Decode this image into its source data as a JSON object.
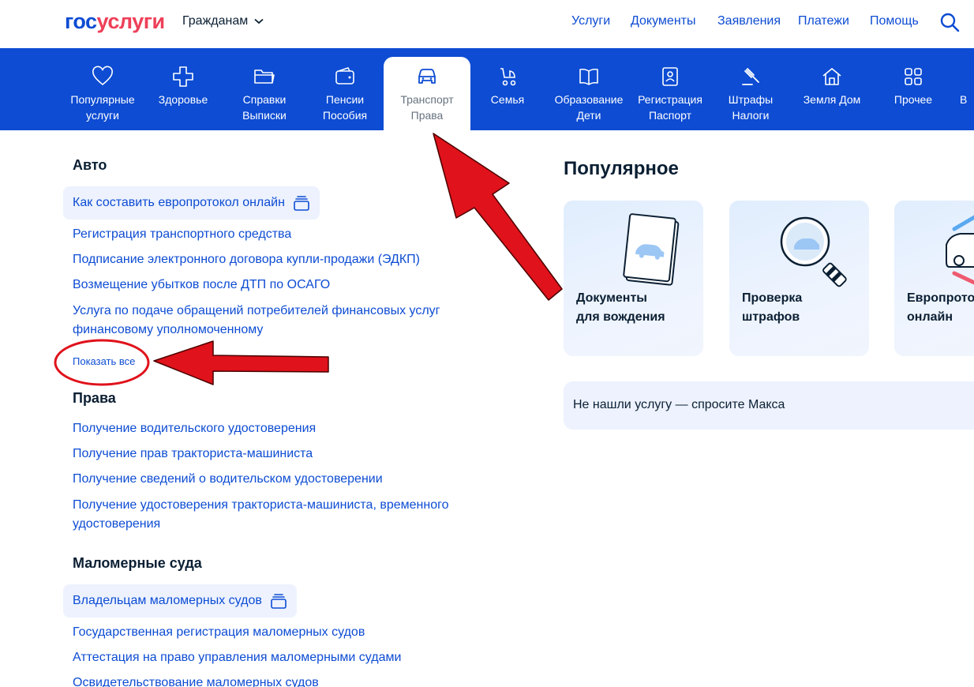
{
  "header": {
    "logo_part1": "гос",
    "logo_part2": "услуги",
    "audience": "Гражданам",
    "nav": [
      "Услуги",
      "Документы",
      "Заявления",
      "Платежи",
      "Помощь"
    ]
  },
  "categories": [
    {
      "label": "Популярные\nуслуги",
      "icon": "heart-icon"
    },
    {
      "label": "Здоровье",
      "icon": "medical-cross-icon"
    },
    {
      "label": "Справки\nВыписки",
      "icon": "folder-icon"
    },
    {
      "label": "Пенсии\nПособия",
      "icon": "wallet-icon"
    },
    {
      "label": "Транспорт\nПрава",
      "icon": "car-icon",
      "active": true
    },
    {
      "label": "Семья",
      "icon": "stroller-icon"
    },
    {
      "label": "Образование\nДети",
      "icon": "book-icon"
    },
    {
      "label": "Регистрация\nПаспорт",
      "icon": "passport-icon"
    },
    {
      "label": "Штрафы\nНалоги",
      "icon": "gavel-icon"
    },
    {
      "label": "Земля Дом",
      "icon": "house-icon"
    },
    {
      "label": "Прочее",
      "icon": "grid-icon"
    },
    {
      "label": "В",
      "icon": ""
    }
  ],
  "sections": {
    "auto": {
      "title": "Авто",
      "chip": "Как составить европротокол онлайн",
      "links": [
        "Регистрация транспортного средства",
        "Подписание электронного договора купли-продажи (ЭДКП)",
        "Возмещение убытков после ДТП по ОСАГО",
        "Услуга по подаче обращений потребителей финансовых услуг",
        "финансовому уполномоченному"
      ],
      "show_all": "Показать все"
    },
    "rights": {
      "title": "Права",
      "links": [
        "Получение водительского удостоверения",
        "Получение прав тракториста-машиниста",
        "Получение сведений о водительском удостоверении",
        "Получение удостоверения тракториста-машиниста, временного",
        "удостоверения"
      ]
    },
    "boats": {
      "title": "Маломерные суда",
      "chip": "Владельцам маломерных судов",
      "links": [
        "Государственная регистрация маломерных судов",
        "Аттестация на право управления маломерными судами",
        "Освидетельствование маломерных судов"
      ]
    }
  },
  "popular": {
    "title": "Популярное",
    "cards": [
      {
        "caption": "Документы\nдля вождения"
      },
      {
        "caption": "Проверка\nштрафов"
      },
      {
        "caption": "Европротокол\nонлайн"
      }
    ],
    "ask": "Не нашли услугу — спросите Макса"
  },
  "colors": {
    "brand_blue": "#0d4cd3",
    "brand_red": "#ee3f58",
    "annotation_red": "#e0121b"
  }
}
